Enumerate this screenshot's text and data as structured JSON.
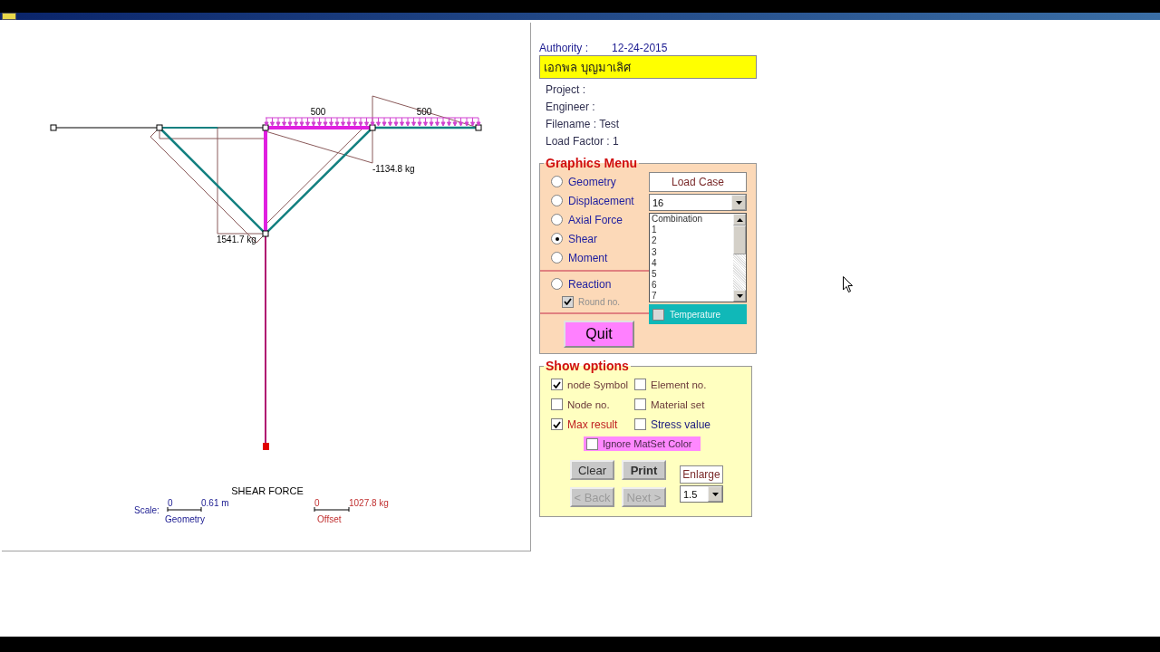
{
  "info": {
    "authority_label": "Authority :",
    "authority_date": "12-24-2015",
    "owner": "เอกพล บุญมาเลิศ",
    "fields": [
      "Project :",
      "Engineer :",
      "Filename : Test",
      "Load Factor :  1"
    ]
  },
  "diagram": {
    "load_labels": [
      "500",
      "500"
    ],
    "max_label": "1541.7 kg",
    "min_label": "-1134.8 kg",
    "title": "SHEAR FORCE",
    "scale_label": "Scale:",
    "geometry_scale": {
      "start": "0",
      "end": "0.61 m",
      "label": "Geometry"
    },
    "offset_scale": {
      "start": "0",
      "end": "1027.8 kg",
      "label": "Offset"
    }
  },
  "graphics_menu": {
    "title": "Graphics Menu",
    "options": [
      {
        "label": "Geometry",
        "selected": false
      },
      {
        "label": "Displacement",
        "selected": false
      },
      {
        "label": "Axial Force",
        "selected": false
      },
      {
        "label": "Shear",
        "selected": true
      },
      {
        "label": "Moment",
        "selected": false
      }
    ],
    "reaction": {
      "label": "Reaction",
      "selected": false
    },
    "round_no": {
      "label": "Round no.",
      "checked": true,
      "disabled": true
    },
    "quit": "Quit",
    "load_case": {
      "title": "Load Case",
      "value": "16",
      "list": [
        "Combination",
        "1",
        "2",
        "3",
        "4",
        "5",
        "6",
        "7"
      ]
    },
    "temperature": {
      "label": "Temperature",
      "checked": false
    }
  },
  "show_options": {
    "title": "Show options",
    "checkboxes": [
      {
        "label": "node Symbol",
        "checked": true,
        "color": "#6b3a3a"
      },
      {
        "label": "Element no.",
        "checked": false,
        "color": "#6b3a3a"
      },
      {
        "label": "Node no.",
        "checked": false,
        "color": "#6b3a3a"
      },
      {
        "label": "Material set",
        "checked": false,
        "color": "#6b3a3a"
      },
      {
        "label": "Max result",
        "checked": true,
        "color": "#c02020"
      },
      {
        "label": "Stress value",
        "checked": false,
        "color": "#202080"
      }
    ],
    "ignore_matset": {
      "label": "Ignore MatSet Color",
      "checked": false
    },
    "buttons": [
      {
        "label": "Clear",
        "disabled": false
      },
      {
        "label": "Print",
        "disabled": false
      },
      {
        "label": "< Back",
        "disabled": true
      },
      {
        "label": "Next >",
        "disabled": true
      }
    ],
    "enlarge": {
      "title": "Enlarge",
      "value": "1.5"
    }
  }
}
